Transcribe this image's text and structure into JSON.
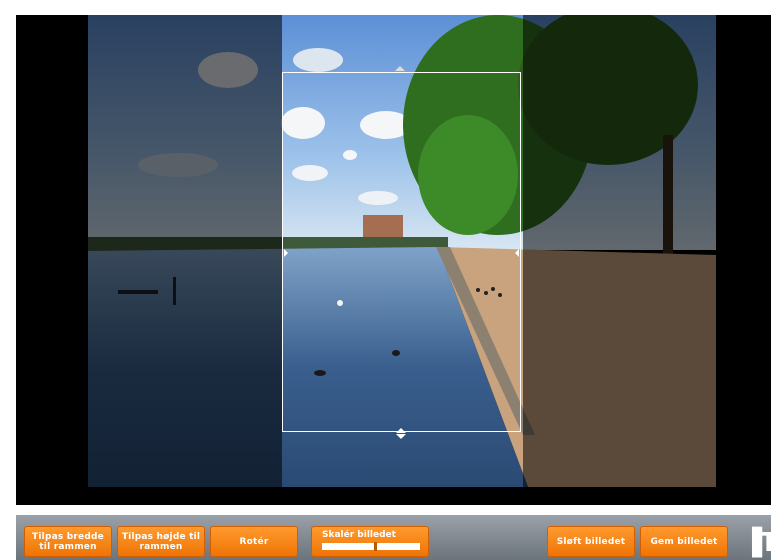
{
  "toolbar": {
    "fit_width_label": "Tilpas bredde til rammen",
    "fit_height_label": "Tilpas højde til rammen",
    "rotate_label": "Rotér",
    "scale_label": "Skalér billedet",
    "scale_value": 0.55,
    "delete_label": "Sløft billedet",
    "save_label": "Gem billedet",
    "logo_text": "▐T"
  },
  "colors": {
    "button_orange": "#f5820f",
    "toolbar_gray": "#7d858d",
    "crop_border": "#ffffff"
  }
}
